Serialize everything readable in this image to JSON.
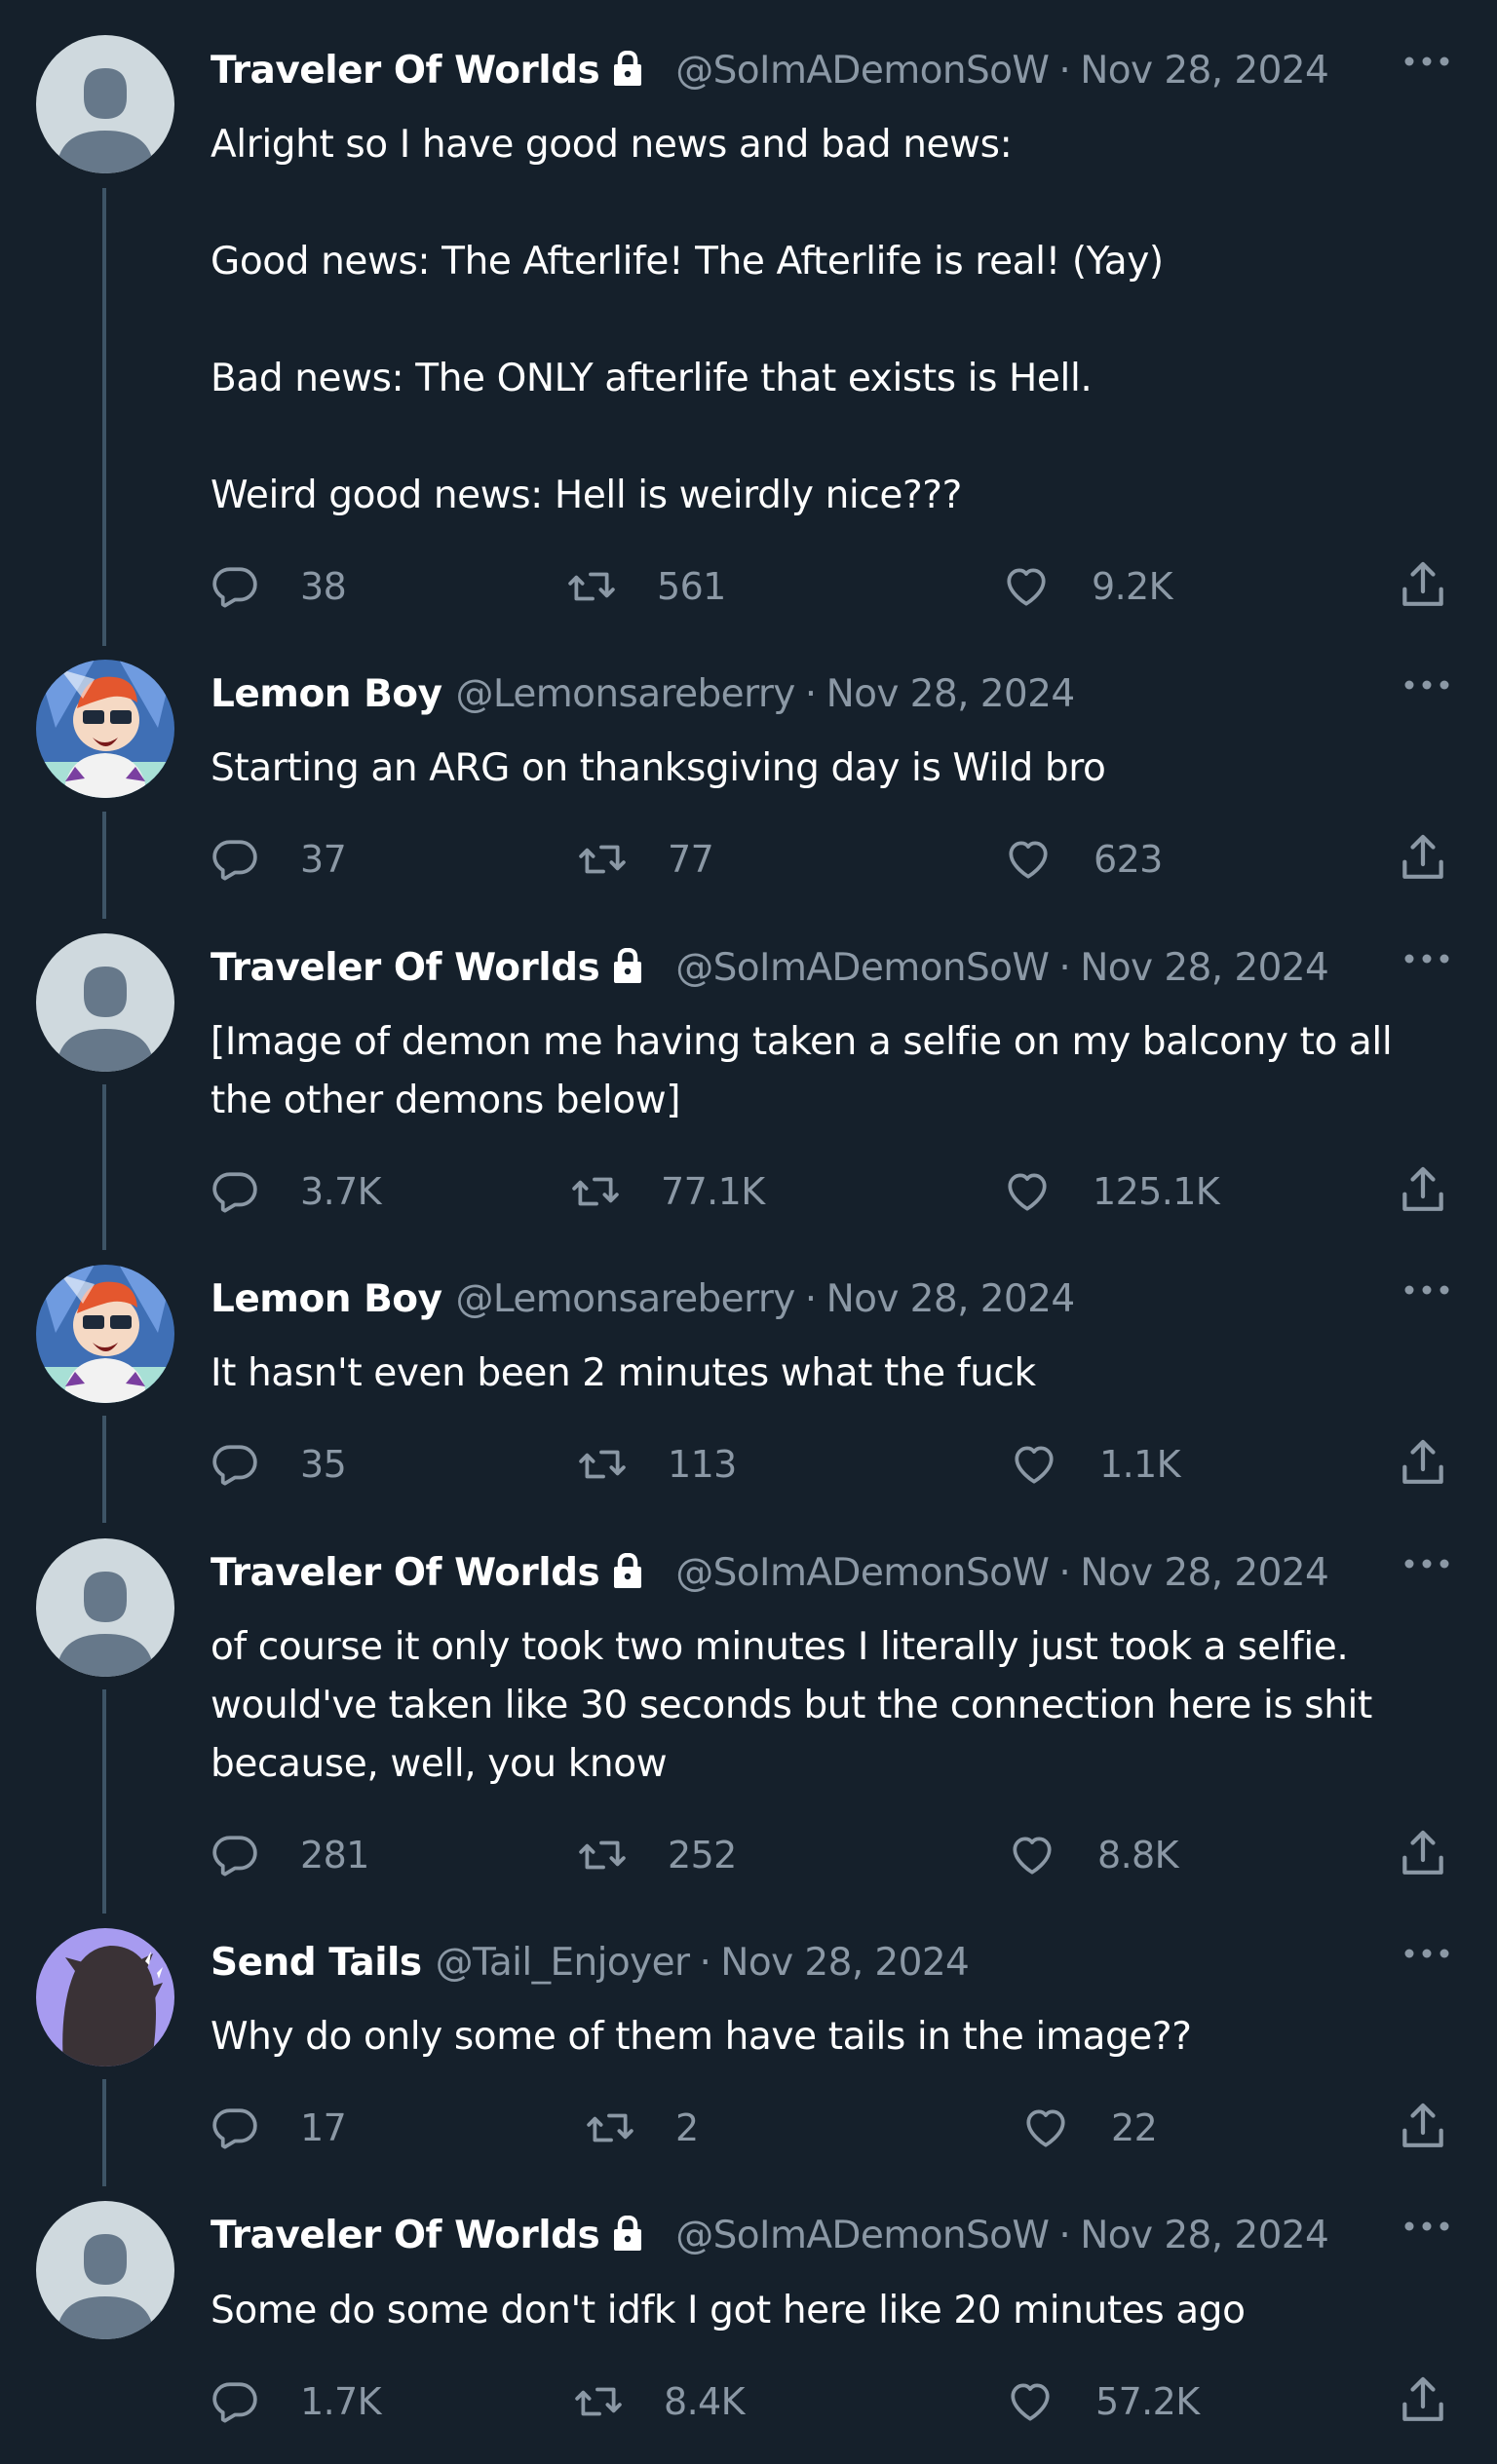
{
  "colors": {
    "background": "#15202b",
    "text_primary": "#ffffff",
    "text_secondary": "#8b98a5",
    "thread_line": "#3d5466"
  },
  "tweets": [
    {
      "author_name": "Traveler Of Worlds",
      "handle": "@SoImADemonSoW",
      "date": "Nov 28, 2024",
      "dot": "·",
      "avatar": "default-avatar",
      "protected": true,
      "text": "Alright so I have good news and bad news:\n\nGood news: The Afterlife! The Afterlife is real! (Yay)\n\nBad news: The ONLY afterlife that exists is Hell.\n\nWeird good news: Hell is weirdly nice???",
      "replies": "38",
      "retweets": "561",
      "likes": "9.2K"
    },
    {
      "author_name": "Lemon Boy",
      "handle": "@Lemonsareberry",
      "date": "Nov 28, 2024",
      "dot": "·",
      "avatar": "cartoon-scientist-avatar",
      "protected": false,
      "text": "Starting an ARG on thanksgiving day is Wild bro",
      "replies": "37",
      "retweets": "77",
      "likes": "623"
    },
    {
      "author_name": "Traveler Of Worlds",
      "handle": "@SoImADemonSoW",
      "date": "Nov 28, 2024",
      "dot": "·",
      "avatar": "default-avatar",
      "protected": true,
      "text": "[Image of demon me having taken a selfie on my balcony to all the other demons below]",
      "replies": "3.7K",
      "retweets": "77.1K",
      "likes": "125.1K"
    },
    {
      "author_name": "Lemon Boy",
      "handle": "@Lemonsareberry",
      "date": "Nov 28, 2024",
      "dot": "·",
      "avatar": "cartoon-scientist-avatar",
      "protected": false,
      "text": "It hasn't even been 2 minutes what the fuck",
      "replies": "35",
      "retweets": "113",
      "likes": "1.1K"
    },
    {
      "author_name": "Traveler Of Worlds",
      "handle": "@SoImADemonSoW",
      "date": "Nov 28, 2024",
      "dot": "·",
      "avatar": "default-avatar",
      "protected": true,
      "text": "of course it only took two minutes I literally just took a selfie. would've taken like 30 seconds but the connection here is shit because, well, you know",
      "replies": "281",
      "retweets": "252",
      "likes": "8.8K"
    },
    {
      "author_name": "Send Tails",
      "handle": "@Tail_Enjoyer",
      "date": "Nov 28, 2024",
      "dot": "·",
      "avatar": "purple-silhouette-avatar",
      "protected": false,
      "text": "Why do only some of them have tails in the image??",
      "replies": "17",
      "retweets": "2",
      "likes": "22"
    },
    {
      "author_name": "Traveler Of Worlds",
      "handle": "@SoImADemonSoW",
      "date": "Nov 28, 2024",
      "dot": "·",
      "avatar": "default-avatar",
      "protected": true,
      "text": "Some do some don't idfk I got here like 20 minutes ago",
      "replies": "1.7K",
      "retweets": "8.4K",
      "likes": "57.2K"
    }
  ]
}
